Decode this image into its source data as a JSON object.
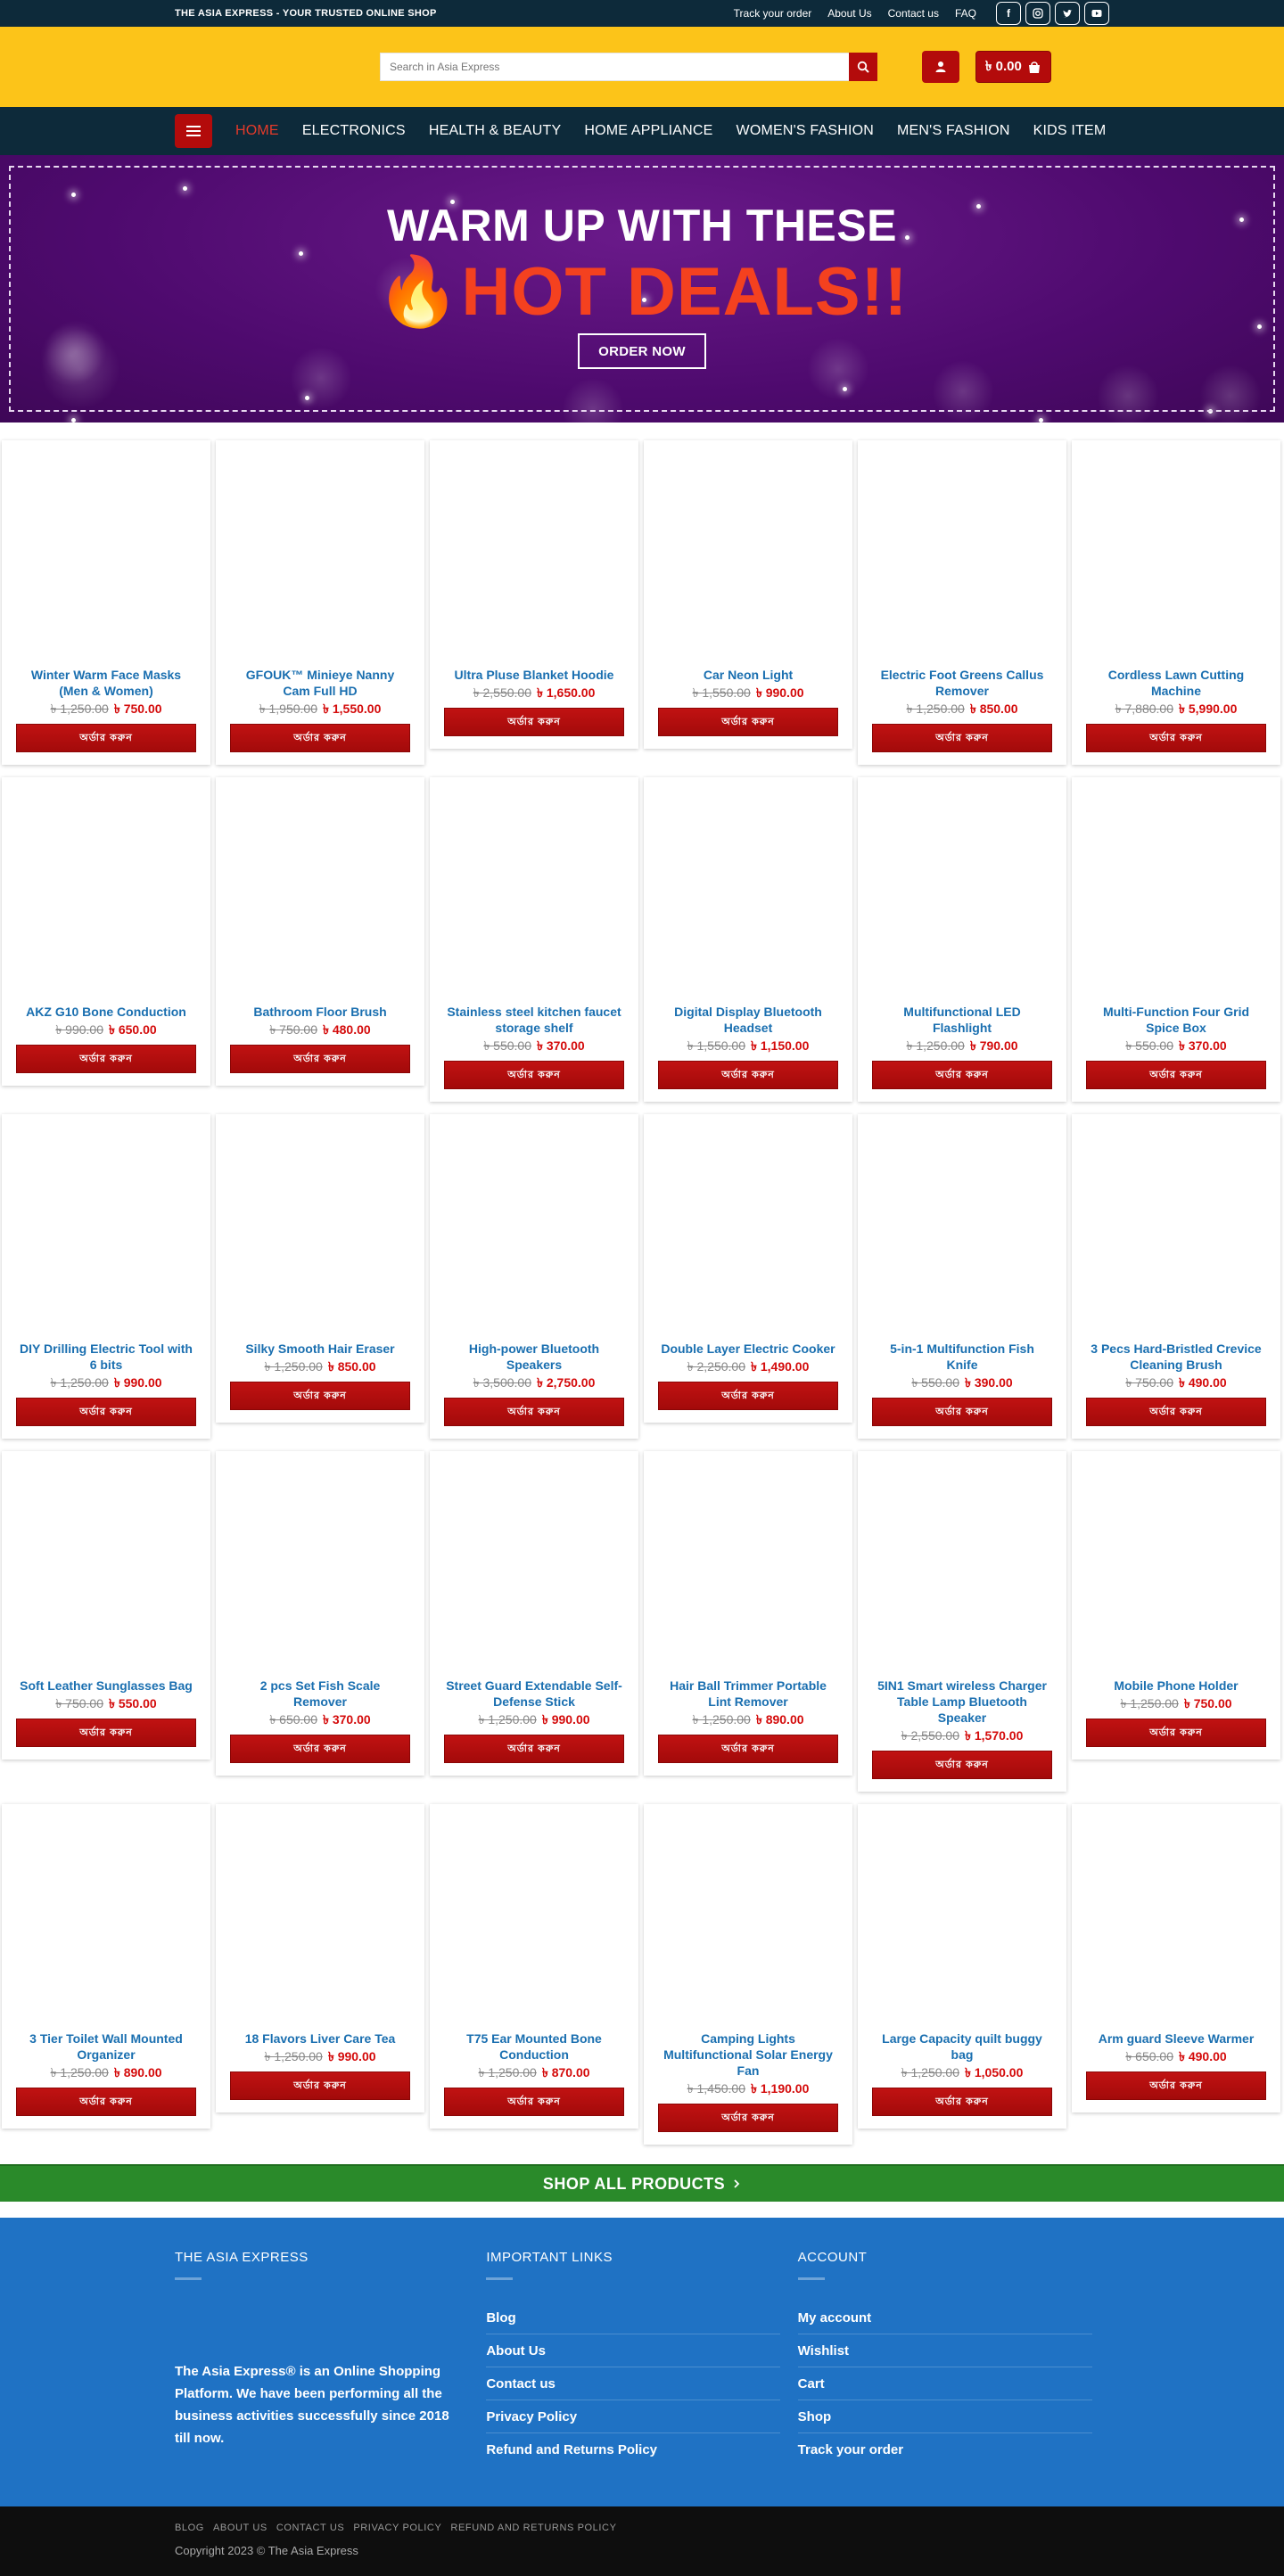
{
  "topbar": {
    "tagline": "THE ASIA EXPRESS - YOUR TRUSTED ONLINE SHOP",
    "links": [
      "Track your order",
      "About Us",
      "Contact us",
      "FAQ"
    ],
    "socials": [
      "facebook-icon",
      "instagram-icon",
      "twitter-icon",
      "youtube-icon"
    ]
  },
  "header": {
    "search_placeholder": "Search in Asia Express",
    "cart_total": "৳ 0.00"
  },
  "nav": {
    "items": [
      "HOME",
      "ELECTRONICS",
      "HEALTH & BEAUTY",
      "HOME APPLIANCE",
      "WOMEN'S FASHION",
      "MEN'S FASHION",
      "KIDS ITEM"
    ]
  },
  "hero": {
    "line1": "WARM UP WITH THESE",
    "line2_emoji": "🔥",
    "line2": "HOT DEALS!!",
    "button": "ORDER NOW"
  },
  "buy_label": "অর্ডার করুন",
  "products": [
    {
      "name": "Winter Warm Face Masks (Men & Women)",
      "old": "৳ 1,250.00",
      "new": "৳ 750.00"
    },
    {
      "name": "GFOUK™ Minieye Nanny Cam Full HD",
      "old": "৳ 1,950.00",
      "new": "৳ 1,550.00"
    },
    {
      "name": "Ultra Pluse Blanket Hoodie",
      "old": "৳ 2,550.00",
      "new": "৳ 1,650.00"
    },
    {
      "name": "Car Neon Light",
      "old": "৳ 1,550.00",
      "new": "৳ 990.00"
    },
    {
      "name": "Electric Foot Greens Callus Remover",
      "old": "৳ 1,250.00",
      "new": "৳ 850.00"
    },
    {
      "name": "Cordless Lawn Cutting Machine",
      "old": "৳ 7,880.00",
      "new": "৳ 5,990.00"
    },
    {
      "name": "AKZ G10 Bone Conduction",
      "old": "৳ 990.00",
      "new": "৳ 650.00"
    },
    {
      "name": "Bathroom Floor Brush",
      "old": "৳ 750.00",
      "new": "৳ 480.00"
    },
    {
      "name": "Stainless steel kitchen faucet storage shelf",
      "old": "৳ 550.00",
      "new": "৳ 370.00"
    },
    {
      "name": "Digital Display Bluetooth Headset",
      "old": "৳ 1,550.00",
      "new": "৳ 1,150.00"
    },
    {
      "name": "Multifunctional LED Flashlight",
      "old": "৳ 1,250.00",
      "new": "৳ 790.00"
    },
    {
      "name": "Multi-Function Four Grid Spice Box",
      "old": "৳ 550.00",
      "new": "৳ 370.00"
    },
    {
      "name": "DIY Drilling Electric Tool with 6 bits",
      "old": "৳ 1,250.00",
      "new": "৳ 990.00"
    },
    {
      "name": "Silky Smooth Hair Eraser",
      "old": "৳ 1,250.00",
      "new": "৳ 850.00"
    },
    {
      "name": "High-power Bluetooth Speakers",
      "old": "৳ 3,500.00",
      "new": "৳ 2,750.00"
    },
    {
      "name": "Double Layer Electric Cooker",
      "old": "৳ 2,250.00",
      "new": "৳ 1,490.00"
    },
    {
      "name": "5-in-1 Multifunction Fish Knife",
      "old": "৳ 550.00",
      "new": "৳ 390.00"
    },
    {
      "name": "3 Pecs Hard-Bristled Crevice Cleaning Brush",
      "old": "৳ 750.00",
      "new": "৳ 490.00"
    },
    {
      "name": "Soft Leather Sunglasses Bag",
      "old": "৳ 750.00",
      "new": "৳ 550.00"
    },
    {
      "name": "2 pcs Set Fish Scale Remover",
      "old": "৳ 650.00",
      "new": "৳ 370.00"
    },
    {
      "name": "Street Guard Extendable Self-Defense Stick",
      "old": "৳ 1,250.00",
      "new": "৳ 990.00"
    },
    {
      "name": "Hair Ball Trimmer Portable Lint Remover",
      "old": "৳ 1,250.00",
      "new": "৳ 890.00"
    },
    {
      "name": "5IN1 Smart wireless Charger Table Lamp Bluetooth Speaker",
      "old": "৳ 2,550.00",
      "new": "৳ 1,570.00"
    },
    {
      "name": "Mobile Phone Holder",
      "old": "৳ 1,250.00",
      "new": "৳ 750.00"
    },
    {
      "name": "3 Tier Toilet Wall Mounted Organizer",
      "old": "৳ 1,250.00",
      "new": "৳ 890.00"
    },
    {
      "name": "18 Flavors Liver Care Tea",
      "old": "৳ 1,250.00",
      "new": "৳ 990.00"
    },
    {
      "name": "T75 Ear Mounted Bone Conduction",
      "old": "৳ 1,250.00",
      "new": "৳ 870.00"
    },
    {
      "name": "Camping Lights Multifunctional Solar Energy Fan",
      "old": "৳ 1,450.00",
      "new": "৳ 1,190.00"
    },
    {
      "name": "Large Capacity quilt buggy bag",
      "old": "৳ 1,250.00",
      "new": "৳ 1,050.00"
    },
    {
      "name": "Arm guard Sleeve Warmer",
      "old": "৳ 650.00",
      "new": "৳ 490.00"
    }
  ],
  "shop_all": "SHOP ALL PRODUCTS",
  "footer": {
    "col1_title": "THE ASIA EXPRESS",
    "about": "The Asia Express® is an Online Shopping Platform. We have been performing all the business activities successfully since 2018 till now.",
    "col2_title": "IMPORTANT LINKS",
    "col2_links": [
      "Blog",
      "About Us",
      "Contact us",
      "Privacy Policy",
      "Refund and Returns Policy"
    ],
    "col3_title": "ACCOUNT",
    "col3_links": [
      "My account",
      "Wishlist",
      "Cart",
      "Shop",
      "Track your order"
    ]
  },
  "bottom": {
    "links": [
      "BLOG",
      "ABOUT US",
      "CONTACT US",
      "PRIVACY POLICY",
      "REFUND AND RETURNS POLICY"
    ],
    "copyright": "Copyright 2023 © The Asia Express"
  }
}
